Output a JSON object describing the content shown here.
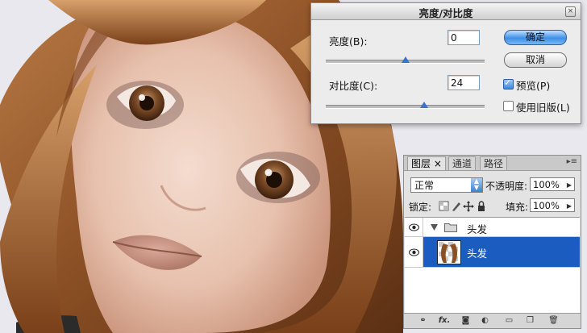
{
  "dialog": {
    "title": "亮度/对比度",
    "brightness": {
      "label": "亮度(B):",
      "value": "0",
      "slider_fraction": 0.5
    },
    "contrast": {
      "label": "对比度(C):",
      "value": "24",
      "slider_fraction": 0.62
    },
    "ok_label": "确定",
    "cancel_label": "取消",
    "preview": {
      "label": "预览(P)",
      "checked": true
    },
    "legacy": {
      "label": "使用旧版(L)",
      "checked": false
    }
  },
  "layers_panel": {
    "tabs": [
      "图层 ×",
      "通道",
      "路径"
    ],
    "blend_mode": "正常",
    "opacity_label": "不透明度:",
    "opacity_value": "100%",
    "lock_label": "锁定:",
    "fill_label": "填充:",
    "fill_value": "100%",
    "layers": [
      {
        "name": "头发",
        "type": "group",
        "visible": true,
        "selected": false
      },
      {
        "name": "头发",
        "type": "layer",
        "visible": true,
        "selected": true
      }
    ],
    "footer_tools": [
      "link-icon",
      "fx-icon",
      "mask-icon",
      "adjustment-icon",
      "folder-icon",
      "new-layer-icon",
      "trash-icon"
    ]
  },
  "colors": {
    "selection": "#1a5cbf",
    "accent_button": "#3f8fe6"
  }
}
